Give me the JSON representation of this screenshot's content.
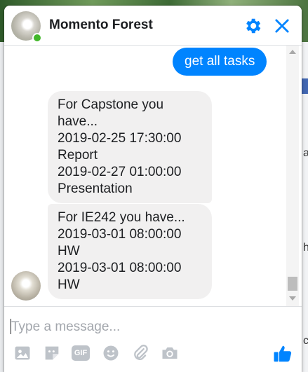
{
  "chat": {
    "title": "Momento Forest",
    "online": true
  },
  "messages": [
    {
      "direction": "outgoing",
      "text": "get all tasks"
    },
    {
      "direction": "incoming",
      "text": "For Capstone you have...\n2019-02-25 17:30:00\nReport\n2019-02-27 01:00:00\nPresentation"
    },
    {
      "direction": "incoming",
      "text": "For IE242 you have...\n2019-03-01 08:00:00\nHW\n2019-03-01 08:00:00\nHW"
    }
  ],
  "composer": {
    "placeholder": "Type a message...",
    "value": "",
    "gif_label": "GIF"
  },
  "icons": {
    "header": [
      "gear-icon",
      "close-icon"
    ],
    "toolbar": [
      "photo-icon",
      "sticker-icon",
      "gif-icon",
      "emoji-icon",
      "attachment-icon",
      "camera-icon",
      "thumbs-up-icon"
    ]
  },
  "background": {
    "right_fragments": [
      "a",
      "h",
      "c"
    ]
  },
  "colors": {
    "accent": "#0084ff",
    "incoming_bubble": "#f1f0f0",
    "icon_gray": "#bec3c9",
    "online": "#42b72a"
  }
}
